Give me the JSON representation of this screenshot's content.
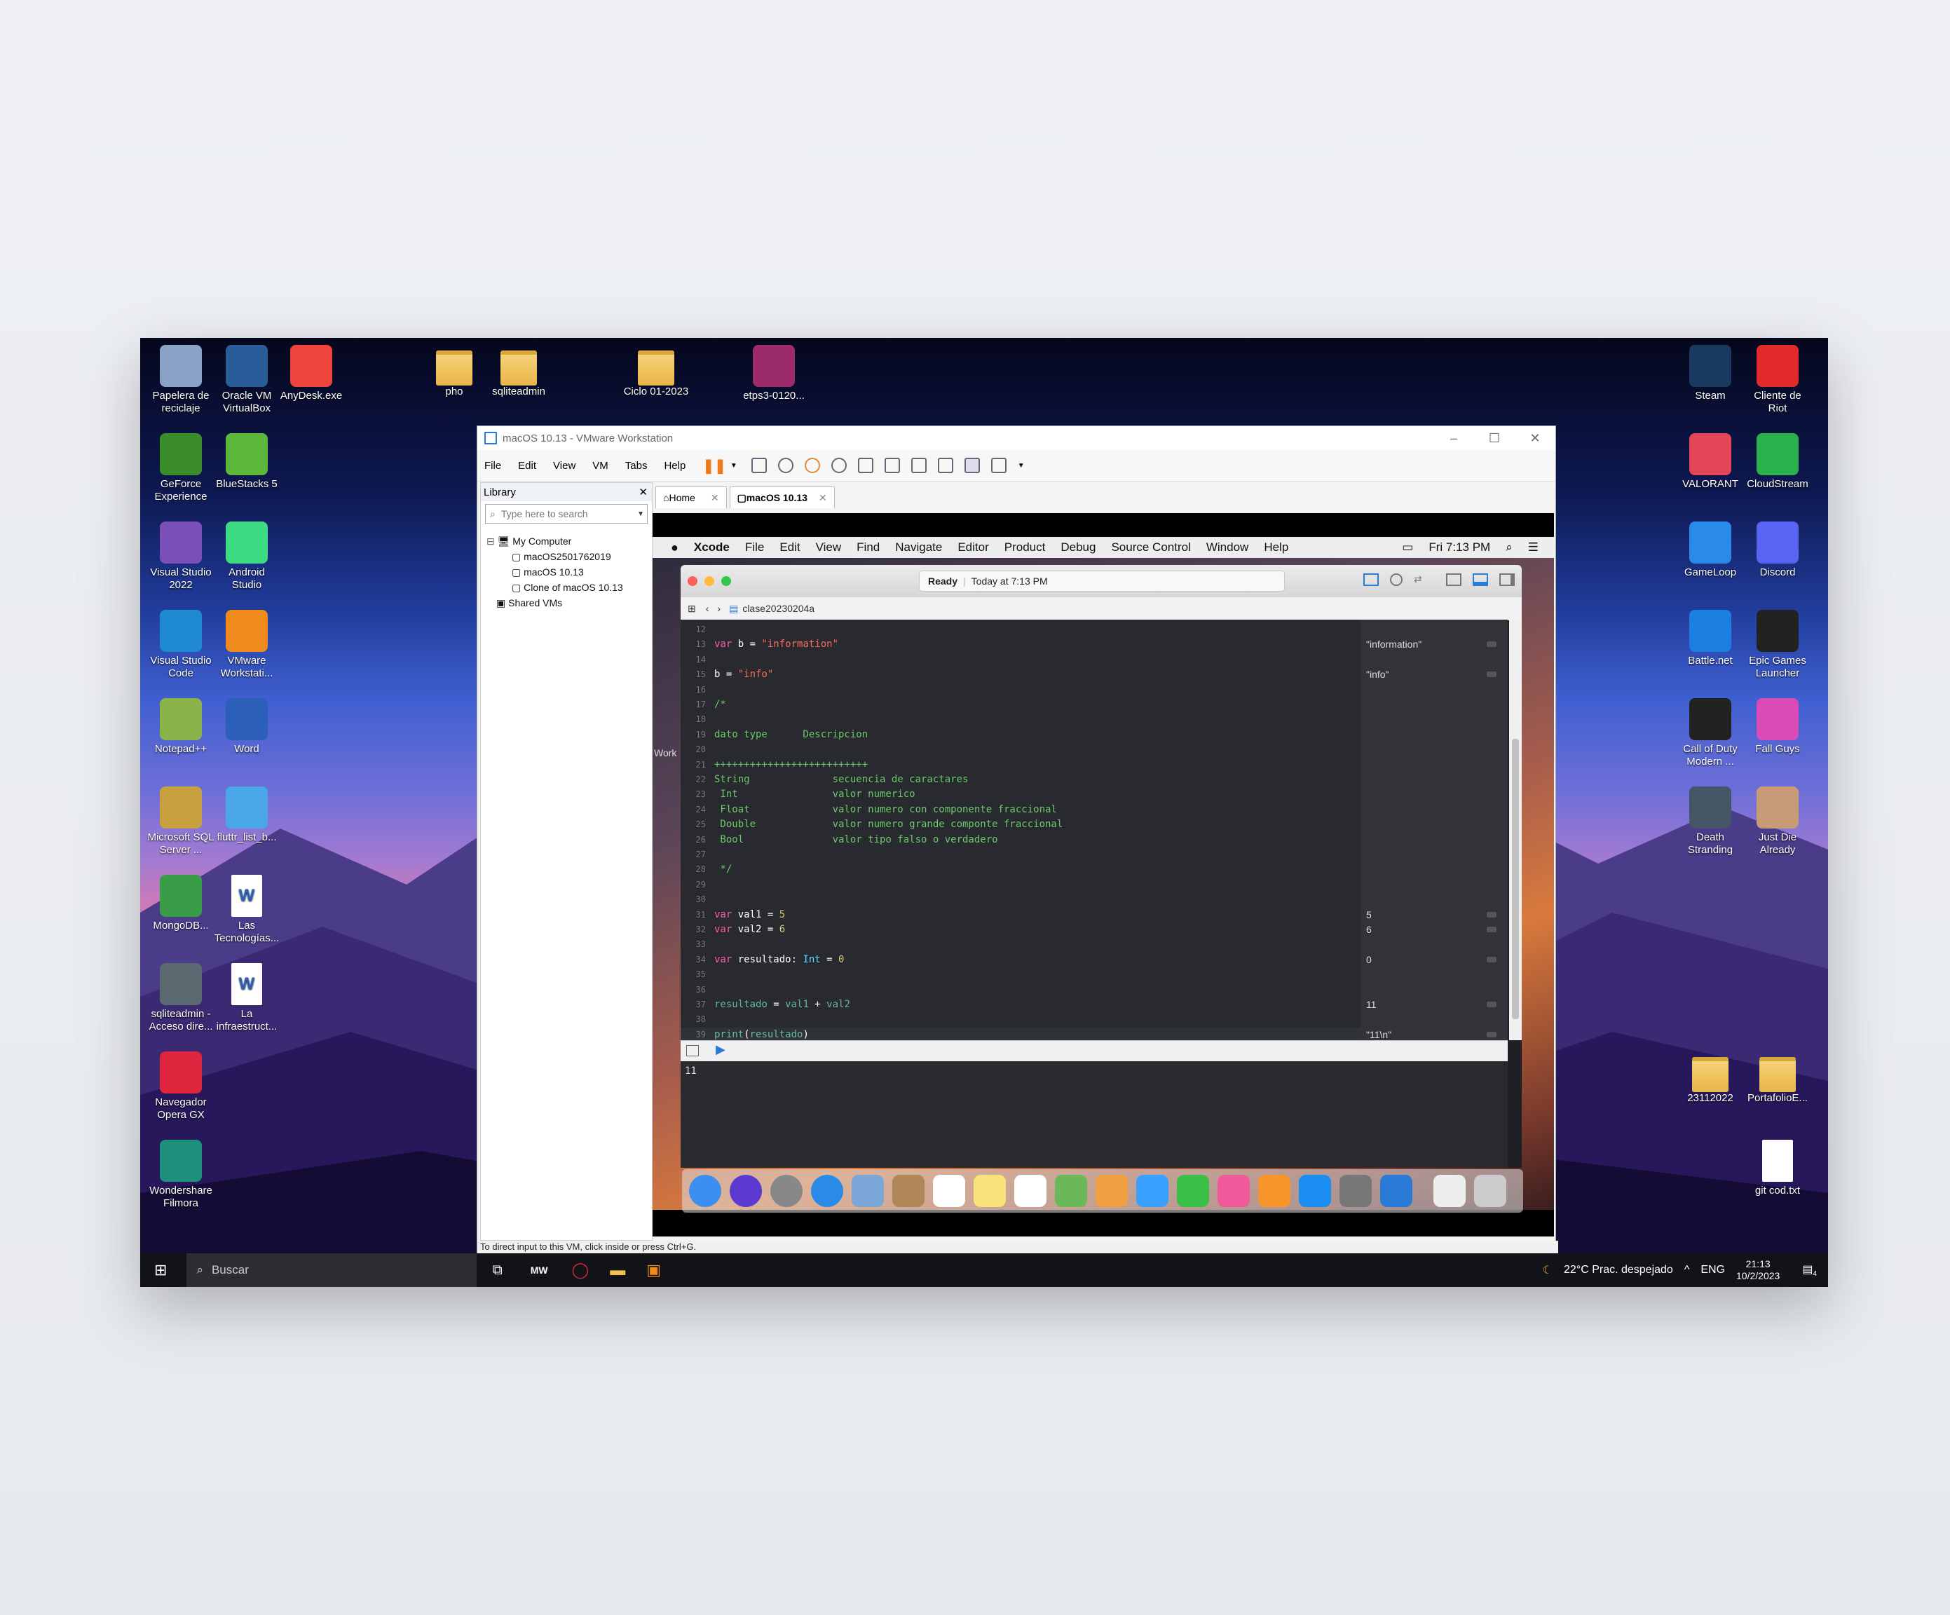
{
  "desktop_icons_left": [
    {
      "label": "Papelera de reciclaje",
      "icon": "recycle-bin-icon",
      "color": "#8aa2c8"
    },
    {
      "label": "Oracle VM VirtualBox",
      "icon": "virtualbox-icon",
      "color": "#2a5c9a"
    },
    {
      "label": "AnyDesk.exe",
      "icon": "anydesk-icon",
      "color": "#ef443b"
    },
    {
      "label": "pho",
      "icon": "folder-icon",
      "color": "#e8b649"
    },
    {
      "label": "sqliteadmin",
      "icon": "folder-icon",
      "color": "#e8b649"
    },
    {
      "label": "Ciclo 01-2023",
      "icon": "folder-icon",
      "color": "#e8b649"
    },
    {
      "label": "etps3-0120...",
      "icon": "winrar-icon",
      "color": "#9b2b6b"
    },
    {
      "label": "GeForce Experience",
      "icon": "geforce-icon",
      "color": "#3a8d2a"
    },
    {
      "label": "BlueStacks 5",
      "icon": "bluestacks-icon",
      "color": "#5bb83a"
    },
    {
      "label": "Visual Studio 2022",
      "icon": "visual-studio-icon",
      "color": "#7b4fb8"
    },
    {
      "label": "Android Studio",
      "icon": "android-studio-icon",
      "color": "#3ddc84"
    },
    {
      "label": "Visual Studio Code",
      "icon": "vscode-icon",
      "color": "#1f8ad2"
    },
    {
      "label": "VMware Workstati...",
      "icon": "vmware-icon",
      "color": "#f08a1c"
    },
    {
      "label": "Notepad++",
      "icon": "notepad-icon",
      "color": "#8ab34a"
    },
    {
      "label": "Word",
      "icon": "word-icon",
      "color": "#2b5fb8"
    },
    {
      "label": "Microsoft SQL Server ...",
      "icon": "sql-server-icon",
      "color": "#c8a040"
    },
    {
      "label": "fluttr_list_b...",
      "icon": "flutter-icon",
      "color": "#4aa8e8"
    },
    {
      "label": "MongoDB...",
      "icon": "mongodb-icon",
      "color": "#3a9b48"
    },
    {
      "label": "Las Tecnologías...",
      "icon": "word-doc-icon",
      "color": "#2b5fb8"
    },
    {
      "label": "sqliteadmin - Acceso dire...",
      "icon": "sqlite-icon",
      "color": "#5a6a70"
    },
    {
      "label": "La infraestruct...",
      "icon": "word-doc-icon",
      "color": "#2b5fb8"
    },
    {
      "label": "Navegador Opera GX",
      "icon": "opera-gx-icon",
      "color": "#e0263e"
    },
    {
      "label": "Wondershare Filmora",
      "icon": "filmora-icon",
      "color": "#1d8f7a"
    }
  ],
  "desktop_icons_right": [
    {
      "label": "Steam",
      "icon": "steam-icon",
      "color": "#1b3a62"
    },
    {
      "label": "Cliente de Riot",
      "icon": "riot-icon",
      "color": "#e32a2a"
    },
    {
      "label": "VALORANT",
      "icon": "valorant-icon",
      "color": "#e24658"
    },
    {
      "label": "CloudStream",
      "icon": "cloudstream-icon",
      "color": "#29b14b"
    },
    {
      "label": "GameLoop",
      "icon": "gameloop-icon",
      "color": "#2a8ae8"
    },
    {
      "label": "Discord",
      "icon": "discord-icon",
      "color": "#5865f2"
    },
    {
      "label": "Battle.net",
      "icon": "battlenet-icon",
      "color": "#1a7fe0"
    },
    {
      "label": "Epic Games Launcher",
      "icon": "epic-games-icon",
      "color": "#222222"
    },
    {
      "label": "Call of Duty Modern ...",
      "icon": "cod-icon",
      "color": "#222222"
    },
    {
      "label": "Fall Guys",
      "icon": "fall-guys-icon",
      "color": "#d94bb5"
    },
    {
      "label": "Death Stranding",
      "icon": "death-stranding-icon",
      "color": "#445566"
    },
    {
      "label": "Just Die Already",
      "icon": "just-die-icon",
      "color": "#c89a76"
    },
    {
      "label": "23112022",
      "icon": "folder-icon",
      "color": "#e8b649"
    },
    {
      "label": "PortafolioE...",
      "icon": "folder-icon",
      "color": "#e8b649"
    },
    {
      "label": "git cod.txt",
      "icon": "text-file-icon",
      "color": "#eeeeee"
    }
  ],
  "vmware": {
    "title": "macOS 10.13 - VMware Workstation",
    "menu": [
      "File",
      "Edit",
      "View",
      "VM",
      "Tabs",
      "Help"
    ],
    "library_title": "Library",
    "search_placeholder": "Type here to search",
    "tree": [
      "My Computer",
      "macOS2501762019",
      "macOS 10.13",
      "Clone of macOS 10.13",
      "Shared VMs"
    ],
    "tabs": [
      "Home",
      "macOS 10.13"
    ],
    "status": "To direct input to this VM, click inside or press Ctrl+G."
  },
  "mac": {
    "app": "Xcode",
    "menu": [
      "File",
      "Edit",
      "View",
      "Find",
      "Navigate",
      "Editor",
      "Product",
      "Debug",
      "Source Control",
      "Window",
      "Help"
    ],
    "clock": "Fri 7:13 PM",
    "activity_status": "Ready",
    "activity_time": "Today at 7:13 PM",
    "file": "clase20230204a",
    "side_label": "Work",
    "console_output": "11"
  },
  "code_lines": [
    {
      "n": "12",
      "parts": []
    },
    {
      "n": "13",
      "parts": [
        {
          "c": "kw",
          "t": "var"
        },
        {
          "c": "plain",
          "t": " b = "
        },
        {
          "c": "str",
          "t": "\"information\""
        }
      ]
    },
    {
      "n": "14",
      "parts": []
    },
    {
      "n": "15",
      "parts": [
        {
          "c": "plain",
          "t": "b = "
        },
        {
          "c": "str",
          "t": "\"info\""
        }
      ]
    },
    {
      "n": "16",
      "parts": []
    },
    {
      "n": "17",
      "parts": [
        {
          "c": "cm",
          "t": "/*"
        }
      ]
    },
    {
      "n": "18",
      "parts": []
    },
    {
      "n": "19",
      "parts": [
        {
          "c": "cm",
          "t": "dato type      Descripcion"
        }
      ]
    },
    {
      "n": "20",
      "parts": []
    },
    {
      "n": "21",
      "parts": [
        {
          "c": "cm",
          "t": "++++++++++++++++++++++++++"
        }
      ]
    },
    {
      "n": "22",
      "parts": [
        {
          "c": "cm",
          "t": "String              secuencia de caractares"
        }
      ]
    },
    {
      "n": "23",
      "parts": [
        {
          "c": "cm",
          "t": " Int                valor numerico"
        }
      ]
    },
    {
      "n": "24",
      "parts": [
        {
          "c": "cm",
          "t": " Float              valor numero con componente fraccional"
        }
      ]
    },
    {
      "n": "25",
      "parts": [
        {
          "c": "cm",
          "t": " Double             valor numero grande componte fraccional"
        }
      ]
    },
    {
      "n": "26",
      "parts": [
        {
          "c": "cm",
          "t": " Bool               valor tipo falso o verdadero"
        }
      ]
    },
    {
      "n": "27",
      "parts": []
    },
    {
      "n": "28",
      "parts": [
        {
          "c": "cm",
          "t": " */"
        }
      ]
    },
    {
      "n": "29",
      "parts": []
    },
    {
      "n": "30",
      "parts": []
    },
    {
      "n": "31",
      "parts": [
        {
          "c": "kw",
          "t": "var"
        },
        {
          "c": "plain",
          "t": " val1 = "
        },
        {
          "c": "num",
          "t": "5"
        }
      ]
    },
    {
      "n": "32",
      "parts": [
        {
          "c": "kw",
          "t": "var"
        },
        {
          "c": "plain",
          "t": " val2 = "
        },
        {
          "c": "num",
          "t": "6"
        }
      ]
    },
    {
      "n": "33",
      "parts": []
    },
    {
      "n": "34",
      "parts": [
        {
          "c": "kw",
          "t": "var"
        },
        {
          "c": "plain",
          "t": " resultado: "
        },
        {
          "c": "ty",
          "t": "Int"
        },
        {
          "c": "plain",
          "t": " = "
        },
        {
          "c": "num",
          "t": "0"
        }
      ]
    },
    {
      "n": "35",
      "parts": []
    },
    {
      "n": "36",
      "parts": []
    },
    {
      "n": "37",
      "parts": [
        {
          "c": "fn",
          "t": "resultado"
        },
        {
          "c": "plain",
          "t": " = "
        },
        {
          "c": "fn",
          "t": "val1"
        },
        {
          "c": "plain",
          "t": " + "
        },
        {
          "c": "fn",
          "t": "val2"
        }
      ]
    },
    {
      "n": "38",
      "parts": []
    },
    {
      "n": "39",
      "parts": [
        {
          "c": "fn",
          "t": "print"
        },
        {
          "c": "plain",
          "t": "("
        },
        {
          "c": "fn",
          "t": "resultado"
        },
        {
          "c": "plain",
          "t": ")"
        }
      ]
    }
  ],
  "results": [
    {
      "line": "13",
      "text": "\"information\""
    },
    {
      "line": "15",
      "text": "\"info\""
    },
    {
      "line": "31",
      "text": "5"
    },
    {
      "line": "32",
      "text": "6"
    },
    {
      "line": "34",
      "text": "0"
    },
    {
      "line": "37",
      "text": "11"
    },
    {
      "line": "39",
      "text": "\"11\\n\""
    }
  ],
  "dock": [
    {
      "name": "finder-icon",
      "color": "#3c8ff0"
    },
    {
      "name": "siri-icon",
      "color": "#5a3ad0"
    },
    {
      "name": "launchpad-icon",
      "color": "#888888"
    },
    {
      "name": "safari-icon",
      "color": "#2a8ae8"
    },
    {
      "name": "mail-icon",
      "color": "#7aa6d8"
    },
    {
      "name": "contacts-icon",
      "color": "#b08858"
    },
    {
      "name": "calendar-icon",
      "color": "#ffffff"
    },
    {
      "name": "notes-icon",
      "color": "#f8e27a"
    },
    {
      "name": "reminders-icon",
      "color": "#ffffff"
    },
    {
      "name": "maps-icon",
      "color": "#6ab85a"
    },
    {
      "name": "photos-icon",
      "color": "#f0a040"
    },
    {
      "name": "messages-icon",
      "color": "#3aa0ff"
    },
    {
      "name": "facetime-icon",
      "color": "#3ac048"
    },
    {
      "name": "itunes-icon",
      "color": "#f05a9a"
    },
    {
      "name": "ibooks-icon",
      "color": "#f5952a"
    },
    {
      "name": "app-store-icon",
      "color": "#1a8ef0"
    },
    {
      "name": "system-preferences-icon",
      "color": "#777777"
    },
    {
      "name": "xcode-icon",
      "color": "#2a7ad8"
    },
    {
      "name": "document-icon",
      "color": "#eeeeee"
    },
    {
      "name": "trash-icon",
      "color": "#cccccc"
    }
  ],
  "taskbar": {
    "search_placeholder": "Buscar",
    "weather": "22°C  Prac. despejado",
    "lang": "ENG",
    "time": "21:13",
    "date": "10/2/2023",
    "notification_count": "4"
  }
}
